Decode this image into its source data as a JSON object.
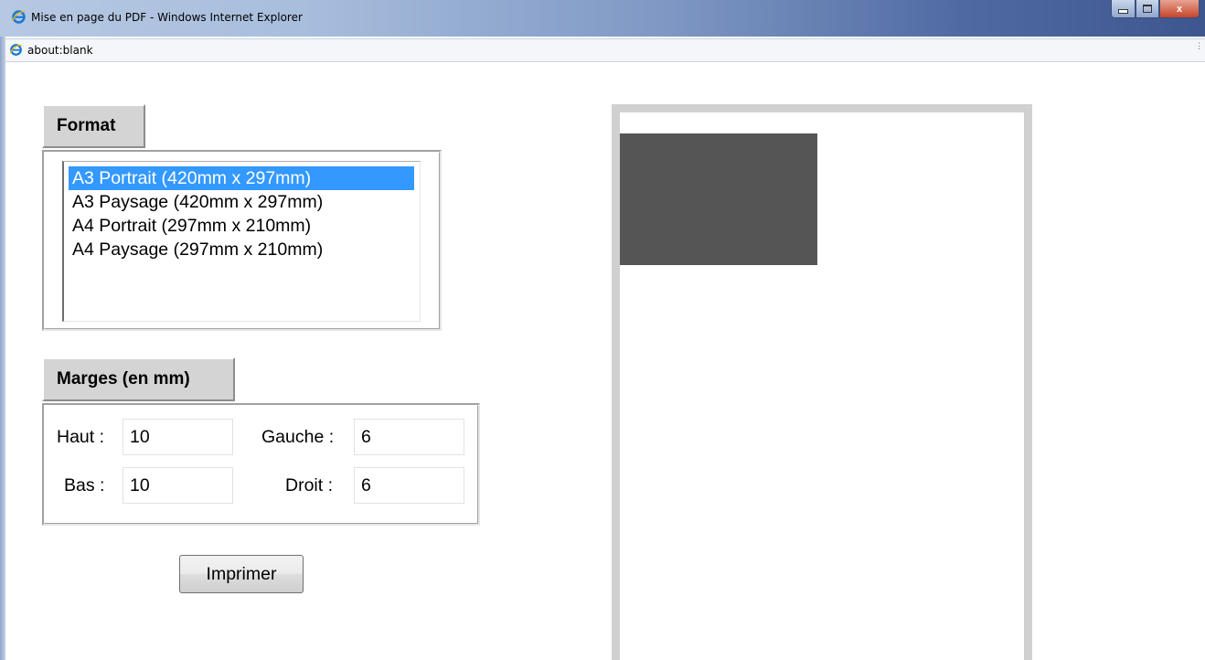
{
  "window": {
    "title": "Mise en page du PDF - Windows Internet Explorer",
    "address": "about:blank",
    "titlebar_gradient": [
      "#b6c8e3",
      "#3e568e"
    ],
    "controls": {
      "minimize": "minimize-icon",
      "maximize": "maximize-icon",
      "close_label": "x"
    }
  },
  "format": {
    "legend": "Format",
    "options": [
      "A3 Portrait (420mm x 297mm)",
      "A3 Paysage (420mm x 297mm)",
      "A4 Portrait (297mm x 210mm)",
      "A4 Paysage (297mm x 210mm)"
    ],
    "selected_index": 0,
    "selection_color": "#3399ff"
  },
  "margins": {
    "legend": "Marges (en mm)",
    "haut_label": "Haut :",
    "haut_value": "10",
    "bas_label": "Bas :",
    "bas_value": "10",
    "gauche_label": "Gauche :",
    "gauche_value": "6",
    "droit_label": "Droit :",
    "droit_value": "6"
  },
  "actions": {
    "print_label": "Imprimer"
  },
  "preview": {
    "page_border_color": "#d0d0d0",
    "block_color": "#555555"
  }
}
